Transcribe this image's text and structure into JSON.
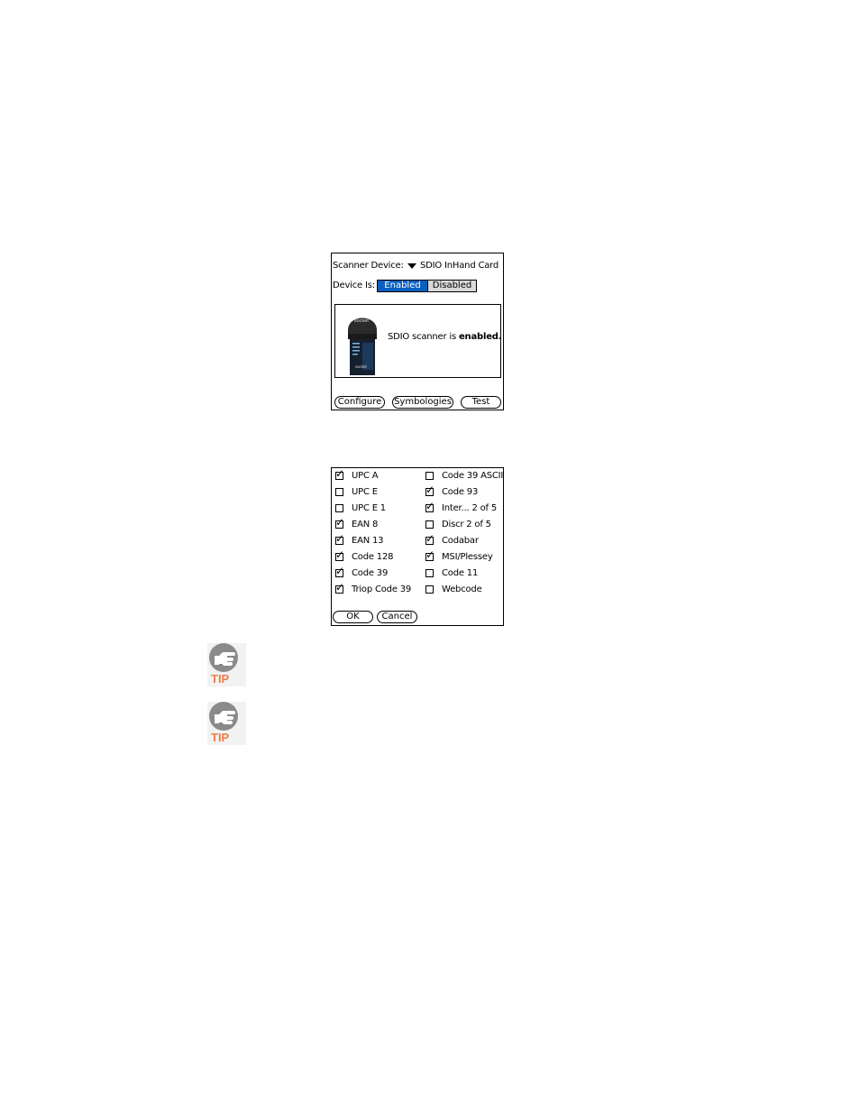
{
  "screen1": {
    "scanner_device_label": "Scanner Device:",
    "scanner_device_value": "SDIO InHand Card",
    "device_is_label": "Device Is:",
    "enabled_label": "Enabled",
    "disabled_label": "Disabled",
    "status_prefix": "SDIO scanner is ",
    "status_value": "enabled.",
    "device_brand": "socket",
    "buttons": {
      "configure": "Configure",
      "symbologies": "Symbologies",
      "test": "Test"
    }
  },
  "screen2": {
    "left": [
      {
        "label": "UPC A",
        "checked": true
      },
      {
        "label": "UPC E",
        "checked": false
      },
      {
        "label": "UPC E 1",
        "checked": false
      },
      {
        "label": "EAN 8",
        "checked": true
      },
      {
        "label": "EAN 13",
        "checked": true
      },
      {
        "label": "Code 128",
        "checked": true
      },
      {
        "label": "Code 39",
        "checked": true
      },
      {
        "label": "Triop Code 39",
        "checked": true
      }
    ],
    "right": [
      {
        "label": "Code 39 ASCII",
        "checked": false
      },
      {
        "label": "Code 93",
        "checked": true
      },
      {
        "label": "Inter... 2 of 5",
        "checked": true
      },
      {
        "label": "Discr 2 of 5",
        "checked": false
      },
      {
        "label": "Codabar",
        "checked": true
      },
      {
        "label": "MSI/Plessey",
        "checked": true
      },
      {
        "label": "Code 11",
        "checked": false
      },
      {
        "label": "Webcode",
        "checked": false
      }
    ],
    "ok_label": "OK",
    "cancel_label": "Cancel"
  },
  "tips": [
    {
      "label": "TIP"
    },
    {
      "label": "TIP"
    }
  ],
  "colors": {
    "selected": "#0a5fbf",
    "tip": "#f07d4a"
  }
}
